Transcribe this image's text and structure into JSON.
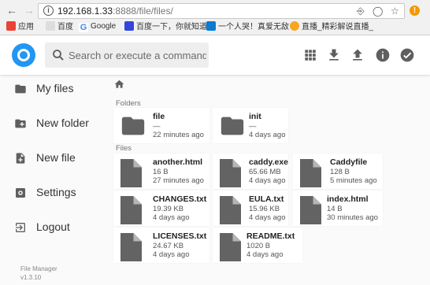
{
  "browser": {
    "url_host": "192.168.1.33",
    "url_rest": ":8888/file/files/",
    "bookmarks": [
      {
        "label": "应用",
        "icon": "apps-grid-icon",
        "color": "#ea4335"
      },
      {
        "label": "百度",
        "icon": "page-icon",
        "color": "#cccccc"
      },
      {
        "label": "Google",
        "icon": "google-icon",
        "color": "#4285f4"
      },
      {
        "label": "百度一下，你就知道",
        "icon": "baidu-paw-icon",
        "color": "#3245df"
      },
      {
        "label": "一个人哭！真爱无敌",
        "icon": "blue-square-icon",
        "color": "#0b7ad1"
      },
      {
        "label": "直播_精彩解说直播_",
        "icon": "bird-icon",
        "color": "#f5a623"
      }
    ]
  },
  "header": {
    "search_placeholder": "Search or execute a command.",
    "buttons": [
      "view-grid-icon",
      "download-icon",
      "upload-icon",
      "info-icon",
      "check-circle-icon"
    ]
  },
  "sidebar": {
    "items": [
      {
        "label": "My files",
        "icon": "folder-icon"
      },
      {
        "label": "New folder",
        "icon": "create-new-folder-icon"
      },
      {
        "label": "New file",
        "icon": "note-add-icon"
      },
      {
        "label": "Settings",
        "icon": "settings-icon"
      },
      {
        "label": "Logout",
        "icon": "exit-icon"
      }
    ],
    "credits_name": "File Manager",
    "credits_version": "v1.3.10"
  },
  "main": {
    "folders_title": "Folders",
    "files_title": "Files",
    "folders": [
      {
        "name": "file",
        "size": "—",
        "modified": "22 minutes ago"
      },
      {
        "name": "init",
        "size": "—",
        "modified": "4 days ago"
      }
    ],
    "files": [
      {
        "name": "another.html",
        "size": "16 B",
        "modified": "27 minutes ago"
      },
      {
        "name": "caddy.exe",
        "size": "65.66 MB",
        "modified": "4 days ago"
      },
      {
        "name": "Caddyfile",
        "size": "128 B",
        "modified": "5 minutes ago"
      },
      {
        "name": "CHANGES.txt",
        "size": "19.39 KB",
        "modified": "4 days ago"
      },
      {
        "name": "EULA.txt",
        "size": "15.96 KB",
        "modified": "4 days ago"
      },
      {
        "name": "index.html",
        "size": "14 B",
        "modified": "30 minutes ago"
      },
      {
        "name": "LICENSES.txt",
        "size": "24.67 KB",
        "modified": "4 days ago"
      },
      {
        "name": "README.txt",
        "size": "1020 B",
        "modified": "4 days ago"
      }
    ]
  },
  "colors": {
    "accent": "#2196f3",
    "icon_grey": "#5f5f5f",
    "tile_bg": "#ffffff"
  }
}
